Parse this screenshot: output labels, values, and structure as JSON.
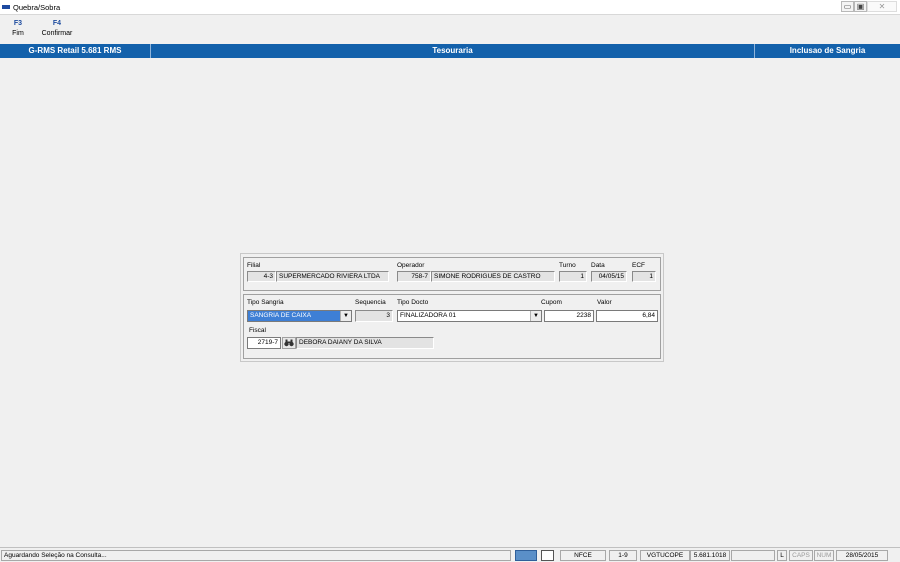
{
  "window": {
    "title": "Quebra/Sobra",
    "minimize": "▭",
    "maximize": "▣",
    "close": "✕"
  },
  "toolbar": [
    {
      "key": "F3",
      "label": "Fim"
    },
    {
      "key": "F4",
      "label": "Confirmar"
    }
  ],
  "header": {
    "system": "G-RMS Retail 5.681 RMS",
    "module": "Tesouraria",
    "operation": "Inclusao de Sangria"
  },
  "form": {
    "filial": {
      "label": "Filial",
      "code": "4-3",
      "name": "SUPERMERCADO RIVIERA LTDA"
    },
    "operador": {
      "label": "Operador",
      "code": "758-7",
      "name": "SIMONE RODRIGUES DE CASTRO"
    },
    "turno": {
      "label": "Turno",
      "value": "1"
    },
    "data": {
      "label": "Data",
      "value": "04/05/15"
    },
    "ecf": {
      "label": "ECF",
      "value": "1"
    },
    "tipo_sangria": {
      "label": "Tipo Sangria",
      "value": "SANGRIA DE CAIXA"
    },
    "sequencia": {
      "label": "Sequencia",
      "value": "3"
    },
    "tipo_docto": {
      "label": "Tipo Docto",
      "value": "FINALIZADORA 01"
    },
    "cupom": {
      "label": "Cupom",
      "value": "2238"
    },
    "valor": {
      "label": "Valor",
      "value": "6,84"
    },
    "fiscal": {
      "label": "Fiscal",
      "code": "2719-7",
      "name": "DEBORA DAIANY DA SILVA"
    },
    "dropdown_glyph": "▼",
    "find_icon": "binoculars-icon"
  },
  "statusbar": {
    "message": "Aguardando Seleção na Consulta...",
    "panels": [
      "NFCE",
      "1-9",
      "VGTUCOPE",
      "5.681.1018",
      "",
      "L",
      "CAPS",
      "NUM",
      "28/05/2015"
    ]
  }
}
